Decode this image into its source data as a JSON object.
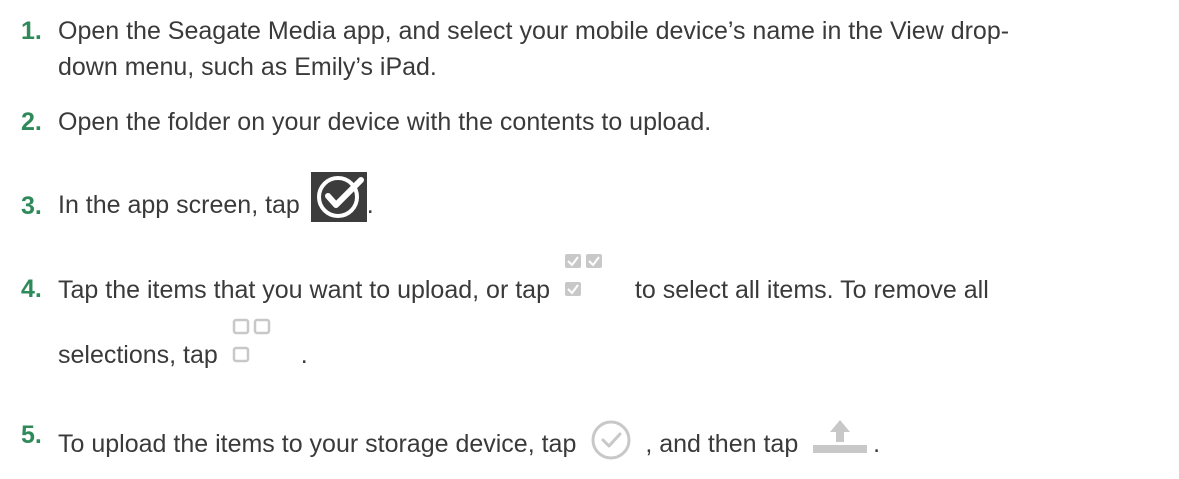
{
  "steps": [
    {
      "number": "1.",
      "line1": "Open the Seagate Media app, and select your mobile device’s name in the View drop-",
      "line2": "down menu, such as Emily’s iPad."
    },
    {
      "number": "2.",
      "text": "Open the folder on your device with the contents to upload."
    },
    {
      "number": "3.",
      "before": "In the app screen, tap",
      "icon": "check-badge-icon",
      "after": "."
    },
    {
      "number": "4.",
      "before": "Tap the items that you want to upload, or tap",
      "icon": "select-all-icon",
      "middle": "to select all items. To remove all",
      "line2_before": "selections, tap",
      "icon2": "deselect-all-icon",
      "line2_after": "."
    },
    {
      "number": "5.",
      "before": "To upload the items to your storage device, tap",
      "icon": "circle-check-icon",
      "middle": ", and then tap",
      "icon2": "upload-icon",
      "after": "."
    }
  ],
  "colors": {
    "step_number": "#2f8a5a",
    "text": "#3a3a3a",
    "icon_light": "#c8c8c8",
    "icon_dark": "#3c3c3c"
  }
}
